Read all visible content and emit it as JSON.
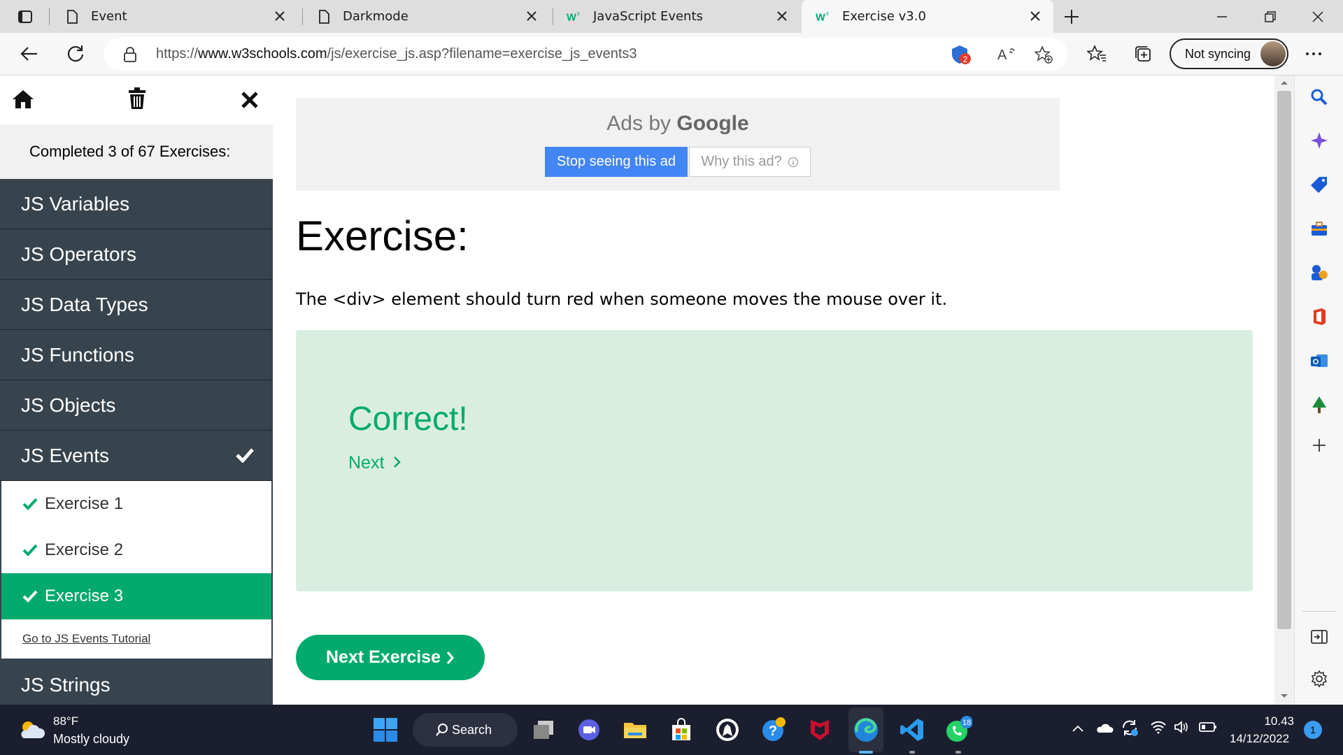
{
  "browser": {
    "tabs": [
      {
        "label": "Event",
        "icon": "page-icon",
        "active": false
      },
      {
        "label": "Darkmode",
        "icon": "page-icon",
        "active": false
      },
      {
        "label": "JavaScript Events",
        "icon": "w3schools-icon",
        "active": false
      },
      {
        "label": "Exercise v3.0",
        "icon": "w3schools-icon",
        "active": true
      }
    ],
    "url_prefix": "https://",
    "url_domain": "www.w3schools.com",
    "url_path": "/js/exercise_js.asp?filename=exercise_js_events3",
    "tracker_badge": "2",
    "sync_label": "Not syncing"
  },
  "sidebar": {
    "progress": "Completed 3 of 67 Exercises:",
    "categories_before": [
      "JS Variables",
      "JS Operators",
      "JS Data Types",
      "JS Functions",
      "JS Objects"
    ],
    "current_category": "JS Events",
    "exercises": [
      {
        "label": "Exercise 1",
        "selected": false
      },
      {
        "label": "Exercise 2",
        "selected": false
      },
      {
        "label": "Exercise 3",
        "selected": true
      }
    ],
    "tutorial_link": "Go to JS Events Tutorial",
    "categories_after": [
      "JS Strings"
    ]
  },
  "ad": {
    "ads_by": "Ads by",
    "google": "Google",
    "stop_label": "Stop seeing this ad",
    "why_label": "Why this ad?"
  },
  "exercise": {
    "title": "Exercise:",
    "description": "The <div> element should turn red when someone moves the mouse over it.",
    "result": "Correct!",
    "next_link": "Next",
    "next_exercise": "Next Exercise"
  },
  "taskbar": {
    "temperature": "88°F",
    "weather": "Mostly cloudy",
    "search_label": "Search",
    "whatsapp_badge": "18",
    "time": "10.43",
    "date": "14/12/2022",
    "notifications": "1"
  },
  "colors": {
    "w3_green": "#04aa6d",
    "sidebar_dark": "#38444d",
    "result_bg": "#d9eee1",
    "google_blue": "#4285f4"
  }
}
